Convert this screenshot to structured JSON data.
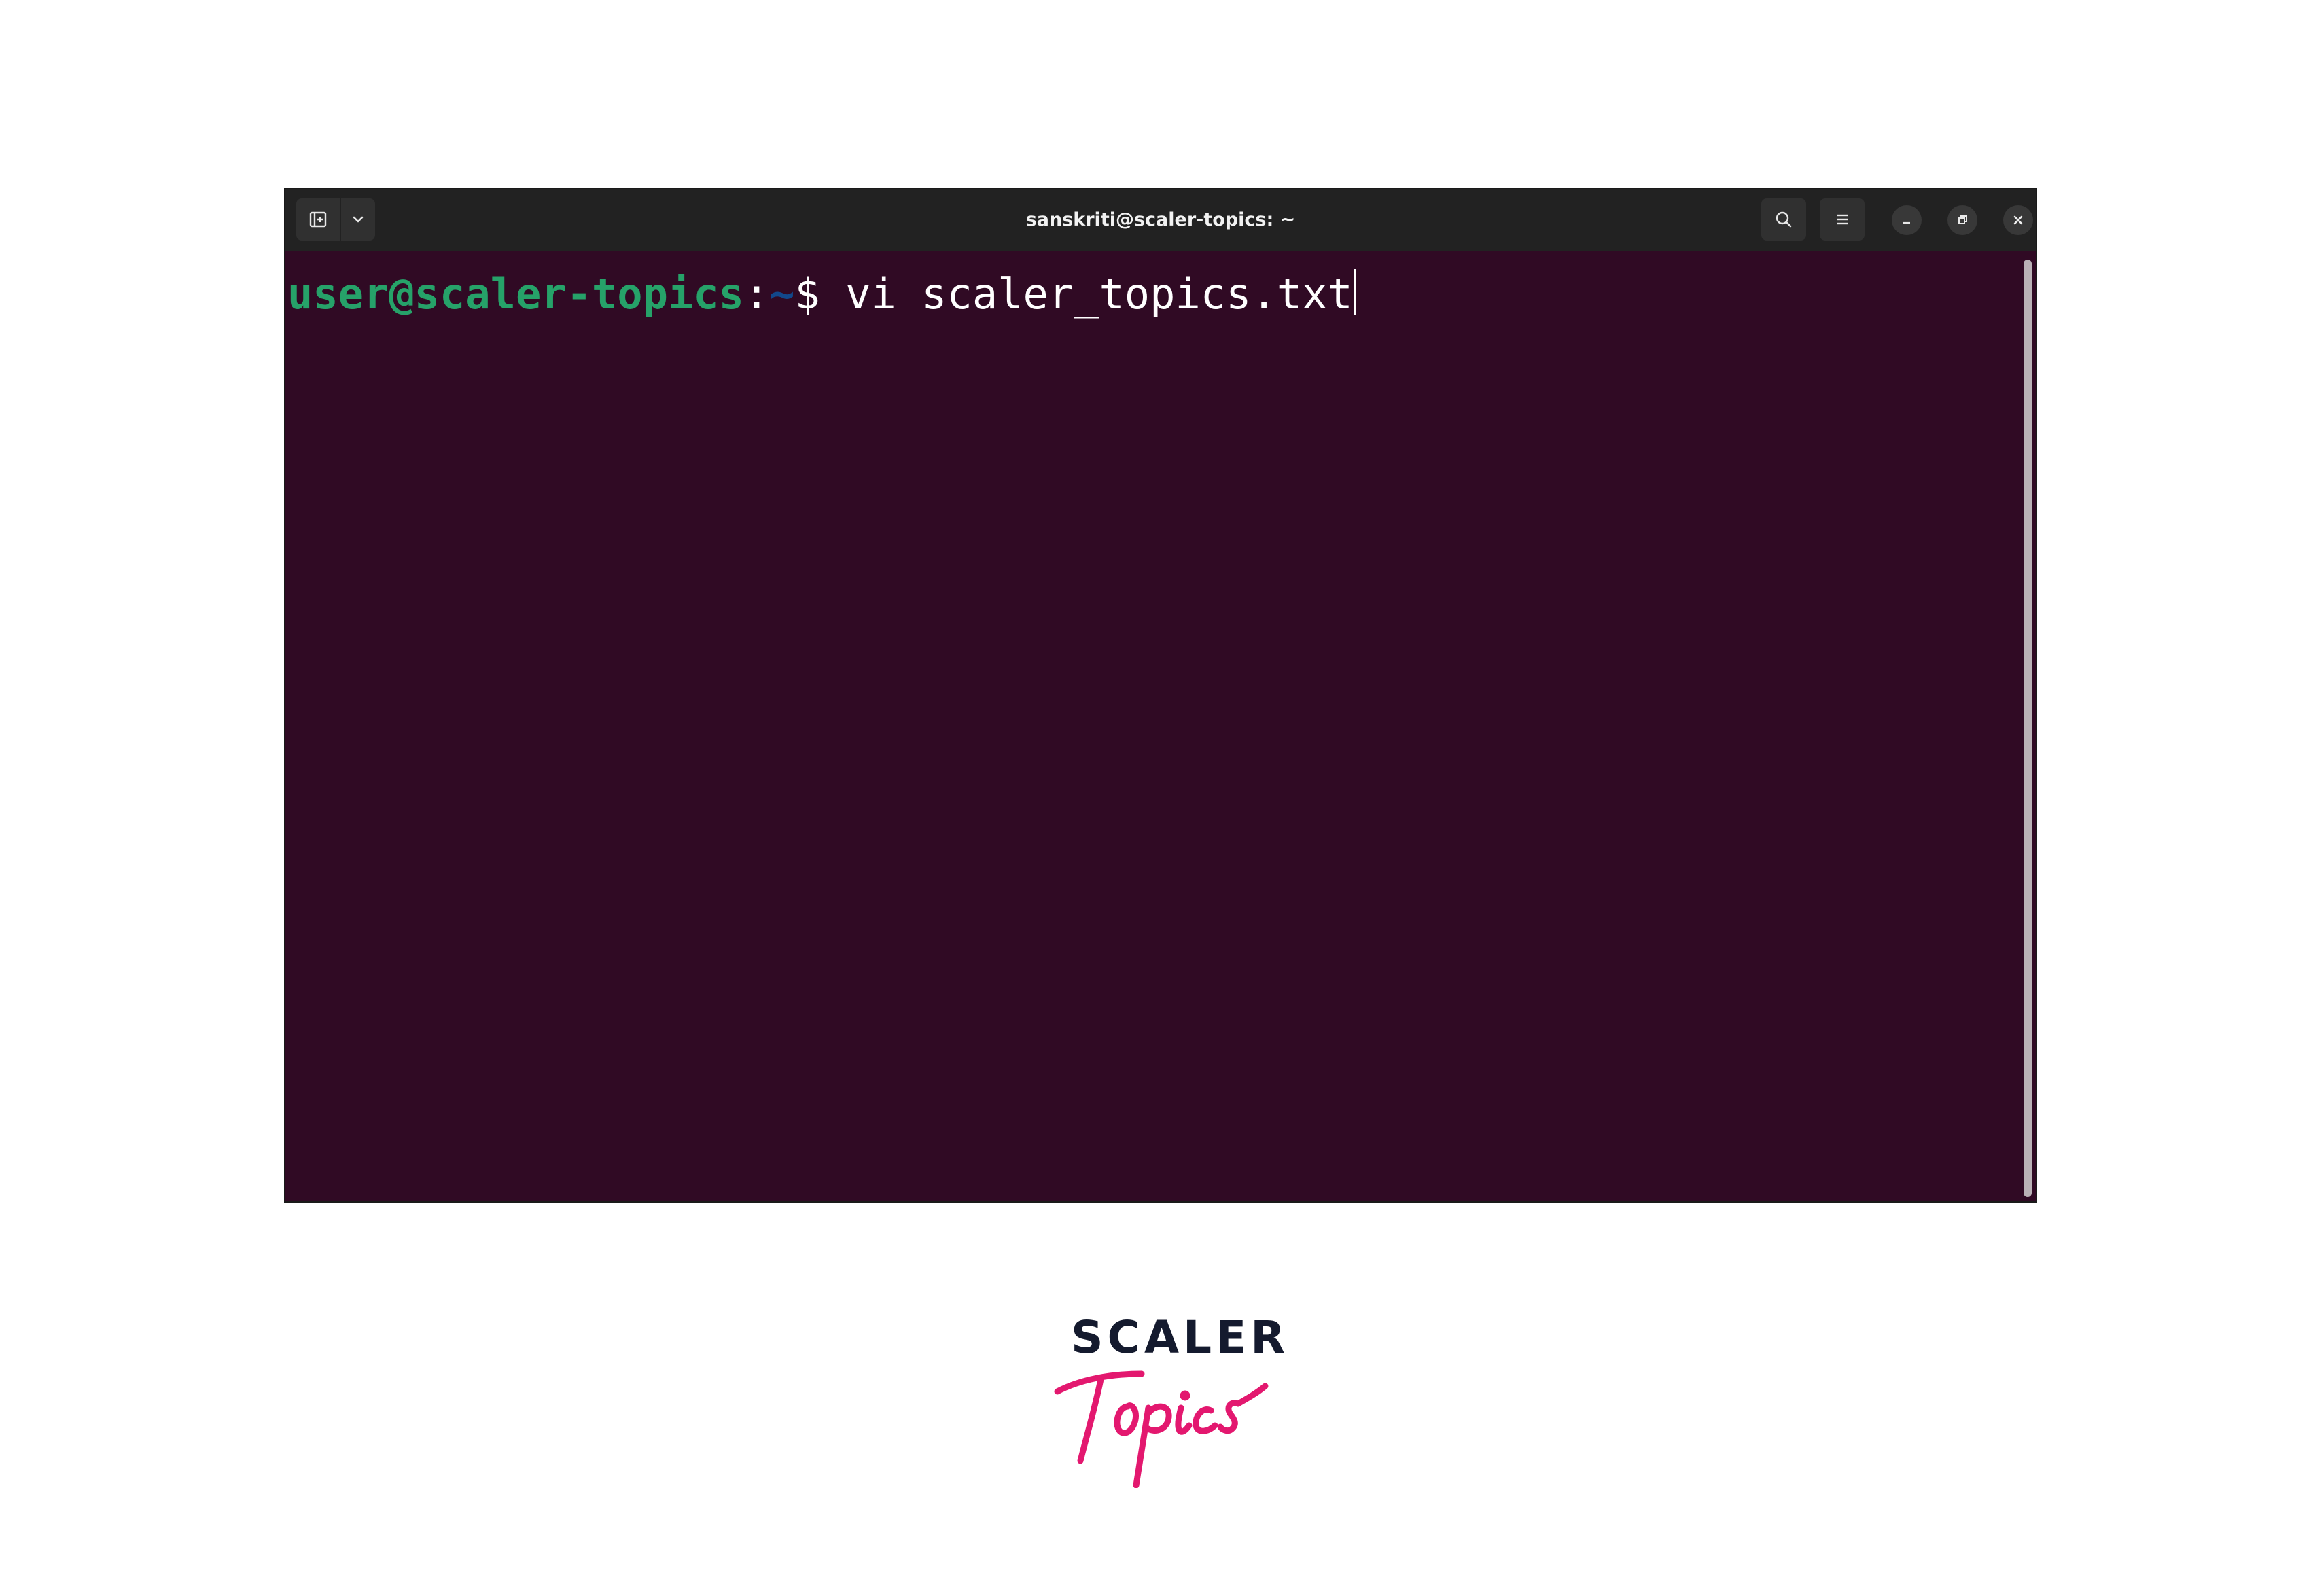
{
  "window": {
    "title": "sanskriti@scaler-topics: ~",
    "buttons": {
      "new_tab": "new-tab-icon",
      "tab_menu": "chevron-down-icon",
      "search": "search-icon",
      "menu": "hamburger-menu-icon",
      "minimize": "minimize-icon",
      "restore": "restore-icon",
      "close": "close-icon"
    }
  },
  "terminal": {
    "prompt_user_host": "user@scaler-topics",
    "prompt_colon": ":",
    "prompt_path": "~",
    "prompt_symbol": "$ ",
    "command": "vi scaler_topics.txt",
    "colors": {
      "background": "#300a24",
      "user_host": "#26a269",
      "path": "#12488b",
      "text": "#ffffff"
    }
  },
  "logo": {
    "word": "SCALER",
    "script": "Topics",
    "colors": {
      "word": "#141a2e",
      "script": "#e3186f"
    }
  }
}
